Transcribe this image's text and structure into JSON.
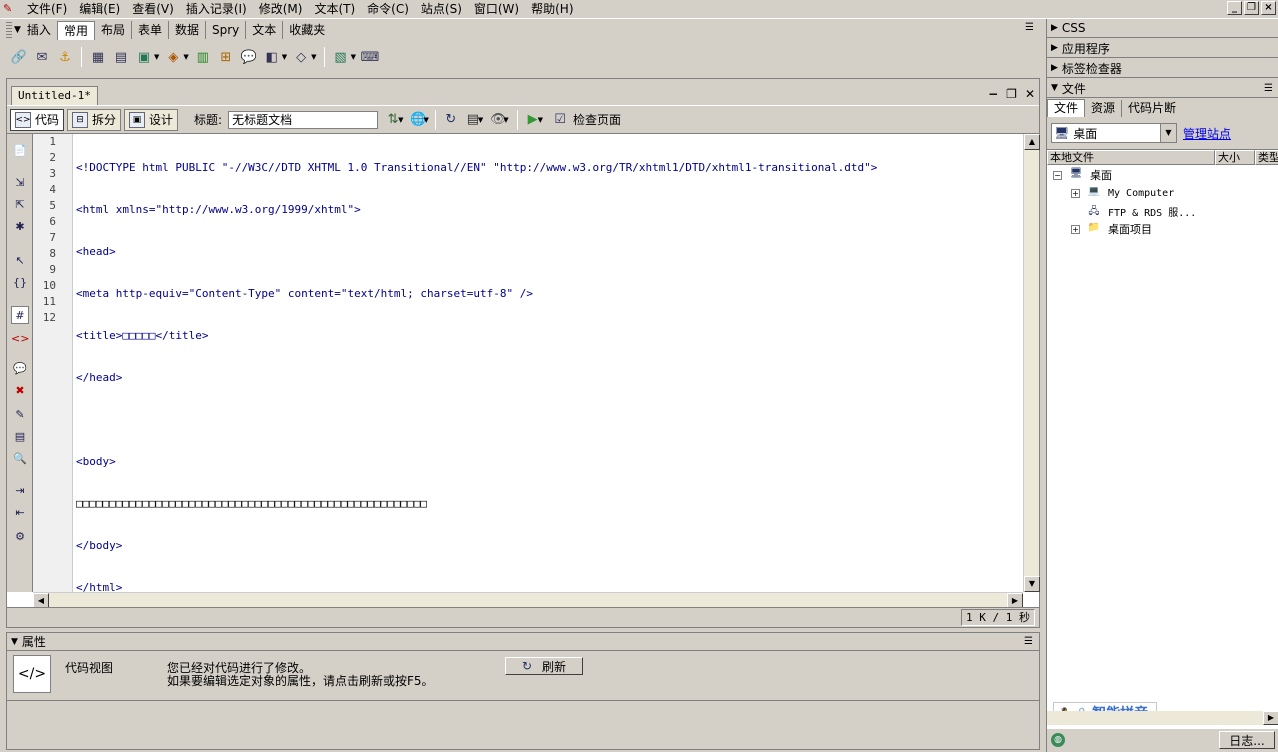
{
  "menubar": {
    "items": [
      "文件(F)",
      "编辑(E)",
      "查看(V)",
      "插入记录(I)",
      "修改(M)",
      "文本(T)",
      "命令(C)",
      "站点(S)",
      "窗口(W)",
      "帮助(H)"
    ]
  },
  "insertbar": {
    "header": "插入",
    "tabs": [
      "常用",
      "布局",
      "表单",
      "数据",
      "Spry",
      "文本",
      "收藏夹"
    ],
    "active_tab": "常用"
  },
  "document": {
    "tab_title": "Untitled-1*",
    "views": {
      "code": "代码",
      "split": "拆分",
      "design": "设计"
    },
    "title_label": "标题:",
    "title_value": "无标题文档",
    "check_page": "检查页面",
    "lines": [
      "<!DOCTYPE html PUBLIC \"-//W3C//DTD XHTML 1.0 Transitional//EN\" \"http://www.w3.org/TR/xhtml1/DTD/xhtml1-transitional.dtd\">",
      "<html xmlns=\"http://www.w3.org/1999/xhtml\">",
      "<head>",
      "<meta http-equiv=\"Content-Type\" content=\"text/html; charset=utf-8\" />",
      "<title>□□□□□</title>",
      "</head>",
      "",
      "<body>",
      "□□□□□□□□□□□□□□□□□□□□□□□□□□□□□□□□□□□□□□□□□□□□□□□□□□□□□",
      "</body>",
      "</html>",
      ""
    ],
    "status_size": "1 K / 1 秒"
  },
  "properties": {
    "header": "属性",
    "view_label": "代码视图",
    "message_line1": "您已经对代码进行了修改。",
    "message_line2": "如果要编辑选定对象的属性，请点击刷新或按F5。",
    "refresh_label": "刷新"
  },
  "panels": {
    "css": "CSS",
    "application": "应用程序",
    "tag_inspector": "标签检查器",
    "files": "文件"
  },
  "files_panel": {
    "tabs": [
      "文件",
      "资源",
      "代码片断"
    ],
    "active_tab": "文件",
    "site_selected": "桌面",
    "manage_sites": "管理站点",
    "columns": {
      "local_files": "本地文件",
      "size": "大小",
      "type": "类型"
    },
    "root": "桌面",
    "items": [
      "My Computer",
      "FTP & RDS 服...",
      "桌面项目"
    ],
    "log_button": "日志...",
    "ime_label": "智能拼音"
  }
}
